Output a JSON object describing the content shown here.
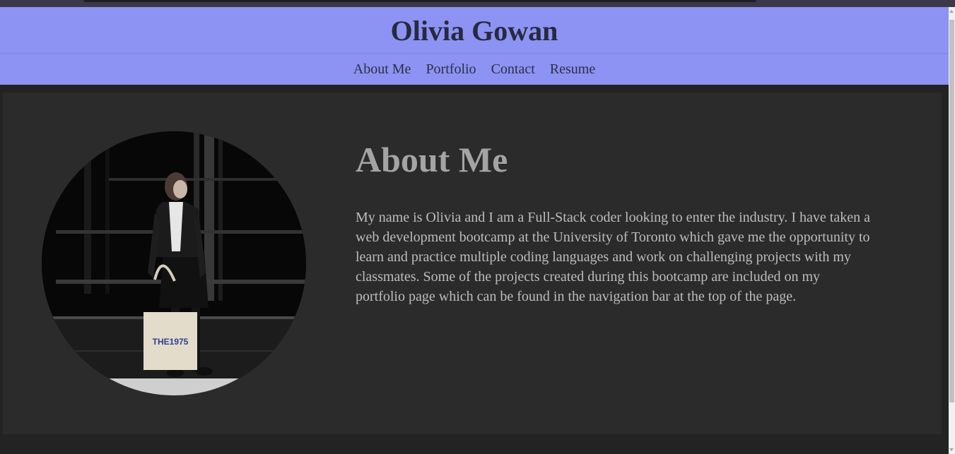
{
  "header": {
    "title": "Olivia Gowan"
  },
  "nav": {
    "items": [
      "About Me",
      "Portfolio",
      "Contact",
      "Resume"
    ]
  },
  "about": {
    "heading": "About Me",
    "text": "My name is Olivia and I am a Full-Stack coder looking to enter the industry. I have taken a web development bootcamp at the University of Toronto which gave me the opportunity to learn and practice multiple coding languages and work on challenging projects with my classmates. Some of the projects created during this bootcamp are included on my portfolio page which can be found in the navigation bar at the top of the page.",
    "photo": {
      "bag_text": "THE1975"
    }
  },
  "colors": {
    "header_bg": "#8c93f3",
    "page_bg": "#232323",
    "card_bg": "#2b2b2b",
    "heading_color": "#a4a4a4",
    "body_text": "#bdbdbd"
  }
}
